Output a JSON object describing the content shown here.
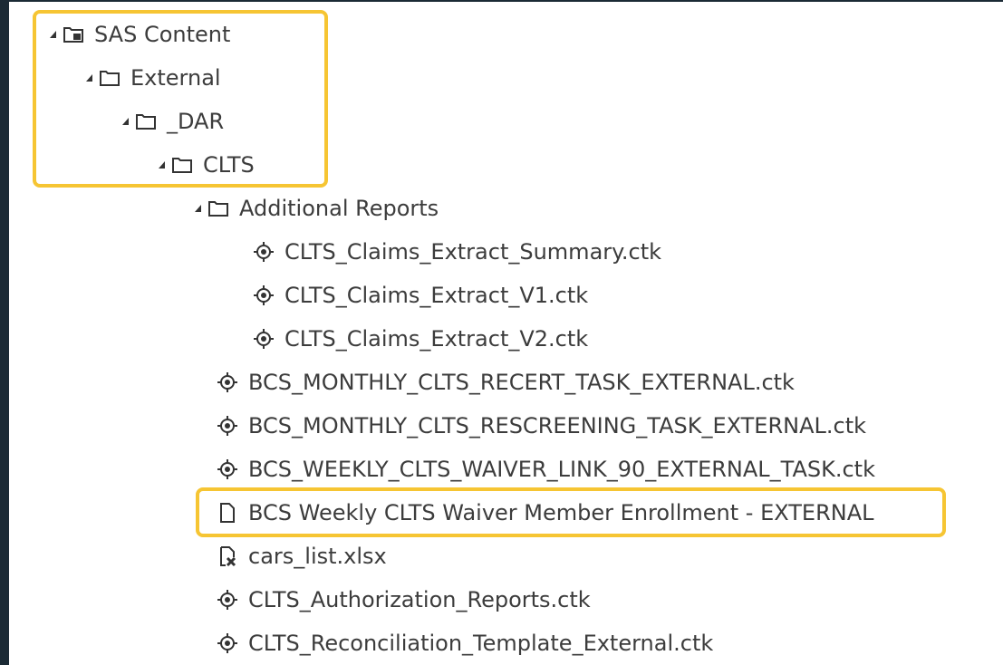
{
  "tree": {
    "items": [
      {
        "label": "SAS Content",
        "icon": "sas-content-icon",
        "expanded": true
      },
      {
        "label": "External",
        "icon": "folder-icon",
        "expanded": true
      },
      {
        "label": "_DAR",
        "icon": "folder-icon",
        "expanded": true
      },
      {
        "label": "CLTS",
        "icon": "folder-icon",
        "expanded": true
      },
      {
        "label": "Additional Reports",
        "icon": "folder-icon",
        "expanded": true
      },
      {
        "label": "CLTS_Claims_Extract_Summary.ctk",
        "icon": "custom-task-icon"
      },
      {
        "label": "CLTS_Claims_Extract_V1.ctk",
        "icon": "custom-task-icon"
      },
      {
        "label": "CLTS_Claims_Extract_V2.ctk",
        "icon": "custom-task-icon"
      },
      {
        "label": "BCS_MONTHLY_CLTS_RECERT_TASK_EXTERNAL.ctk",
        "icon": "custom-task-icon"
      },
      {
        "label": "BCS_MONTHLY_CLTS_RESCREENING_TASK_EXTERNAL.ctk",
        "icon": "custom-task-icon"
      },
      {
        "label": "BCS_WEEKLY_CLTS_WAIVER_LINK_90_EXTERNAL_TASK.ctk",
        "icon": "custom-task-icon"
      },
      {
        "label": "BCS Weekly CLTS Waiver Member Enrollment - EXTERNAL",
        "icon": "document-icon"
      },
      {
        "label": "cars_list.xlsx",
        "icon": "excel-file-icon"
      },
      {
        "label": "CLTS_Authorization_Reports.ctk",
        "icon": "custom-task-icon"
      },
      {
        "label": "CLTS_Reconciliation_Template_External.ctk",
        "icon": "custom-task-icon"
      }
    ]
  },
  "colors": {
    "highlight": "#f6c533",
    "text": "#3c3c3c",
    "background_frame": "#1b2a35"
  }
}
